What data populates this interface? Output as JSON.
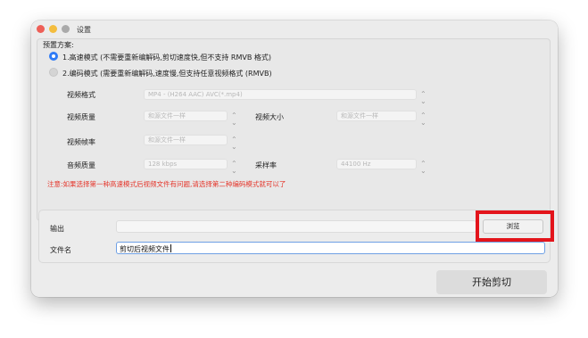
{
  "window": {
    "title": "设置"
  },
  "preset": {
    "heading": "预置方案:",
    "option_fast": "1.高速模式 (不需要重新编解码,剪切速度快,但不支持 RMVB 格式)",
    "option_encode": "2.编码模式 (需要重新编解码,速度慢,但支持任意视频格式 (RMVB)"
  },
  "settings": {
    "video_format_label": "视频格式",
    "video_format_value": "MP4 - (H264 AAC) AVC(*.mp4)",
    "video_quality_label": "视频质量",
    "video_quality_value": "和源文件一样",
    "video_size_label": "视频大小",
    "video_size_value": "和源文件一样",
    "frame_rate_label": "视频帧率",
    "frame_rate_value": "和源文件一样",
    "audio_quality_label": "音频质量",
    "audio_quality_value": "128 kbps",
    "sample_rate_label": "采样率",
    "sample_rate_value": "44100 Hz"
  },
  "notice": "注意:如果选择第一种高速模式后视频文件有问题,请选择第二种编码模式就可以了",
  "output": {
    "output_label": "输出",
    "output_value": "",
    "browse_label": "浏览",
    "filename_label": "文件名",
    "filename_value": "剪切后视频文件"
  },
  "actions": {
    "start_label": "开始剪切"
  },
  "colors": {
    "accent": "#2f7bf6",
    "warning": "#e5362b",
    "highlight_box": "#e3141b"
  },
  "icons": {
    "dropdown": "up-down-chevron-icon"
  }
}
